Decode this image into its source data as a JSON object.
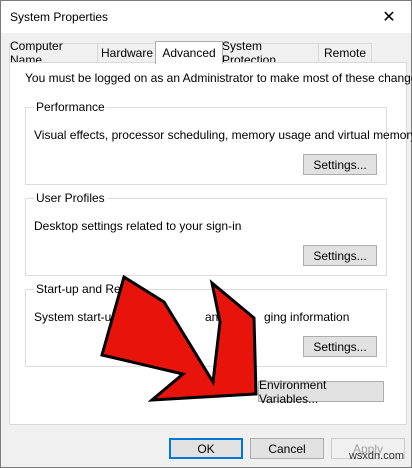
{
  "window": {
    "title": "System Properties",
    "close_glyph": "✕"
  },
  "tabs": [
    {
      "label": "Computer Name",
      "active": false
    },
    {
      "label": "Hardware",
      "active": false
    },
    {
      "label": "Advanced",
      "active": true
    },
    {
      "label": "System Protection",
      "active": false
    },
    {
      "label": "Remote",
      "active": false
    }
  ],
  "advanced": {
    "admin_note": "You must be logged on as an Administrator to make most of these changes.",
    "performance": {
      "label": "Performance",
      "description": "Visual effects, processor scheduling, memory usage and virtual memory",
      "settings_button": "Settings..."
    },
    "user_profiles": {
      "label": "User Profiles",
      "description": "Desktop settings related to your sign-in",
      "settings_button": "Settings..."
    },
    "startup_recovery": {
      "label": "Start-up and Reco",
      "description_left": "System start-up",
      "description_right": "and de",
      "description_tail": "ging information",
      "settings_button": "Settings..."
    },
    "env_vars_button": "Environment Variables..."
  },
  "footer": {
    "ok": "OK",
    "cancel": "Cancel",
    "apply": "Apply"
  },
  "watermark": "wsxdn.com",
  "colors": {
    "arrow_fill": "#e8140c",
    "arrow_stroke": "#000000",
    "focus_border": "#0078d7"
  }
}
